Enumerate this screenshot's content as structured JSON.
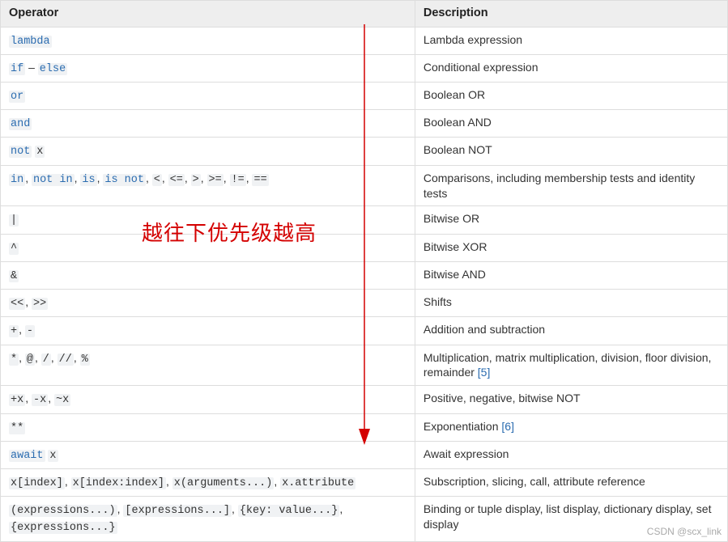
{
  "headers": {
    "operator": "Operator",
    "description": "Description"
  },
  "rows": [
    {
      "op_parts": [
        {
          "t": "link",
          "v": "lambda"
        }
      ],
      "desc_parts": [
        {
          "t": "text",
          "v": "Lambda expression"
        }
      ]
    },
    {
      "op_parts": [
        {
          "t": "link",
          "v": "if"
        },
        {
          "t": "text",
          "v": " – "
        },
        {
          "t": "link",
          "v": "else"
        }
      ],
      "desc_parts": [
        {
          "t": "text",
          "v": "Conditional expression"
        }
      ]
    },
    {
      "op_parts": [
        {
          "t": "link",
          "v": "or"
        }
      ],
      "desc_parts": [
        {
          "t": "text",
          "v": "Boolean OR"
        }
      ]
    },
    {
      "op_parts": [
        {
          "t": "link",
          "v": "and"
        }
      ],
      "desc_parts": [
        {
          "t": "text",
          "v": "Boolean AND"
        }
      ]
    },
    {
      "op_parts": [
        {
          "t": "link",
          "v": "not"
        },
        {
          "t": "text",
          "v": " "
        },
        {
          "t": "code",
          "v": "x"
        }
      ],
      "desc_parts": [
        {
          "t": "text",
          "v": "Boolean NOT"
        }
      ]
    },
    {
      "op_parts": [
        {
          "t": "link",
          "v": "in"
        },
        {
          "t": "text",
          "v": ", "
        },
        {
          "t": "link",
          "v": "not in"
        },
        {
          "t": "text",
          "v": ", "
        },
        {
          "t": "link",
          "v": "is"
        },
        {
          "t": "text",
          "v": ", "
        },
        {
          "t": "link",
          "v": "is not"
        },
        {
          "t": "text",
          "v": ", "
        },
        {
          "t": "code",
          "v": "<"
        },
        {
          "t": "text",
          "v": ", "
        },
        {
          "t": "code",
          "v": "<="
        },
        {
          "t": "text",
          "v": ", "
        },
        {
          "t": "code",
          "v": ">"
        },
        {
          "t": "text",
          "v": ", "
        },
        {
          "t": "code",
          "v": ">="
        },
        {
          "t": "text",
          "v": ", "
        },
        {
          "t": "code",
          "v": "!="
        },
        {
          "t": "text",
          "v": ", "
        },
        {
          "t": "code",
          "v": "=="
        }
      ],
      "desc_parts": [
        {
          "t": "text",
          "v": "Comparisons, including membership tests and identity tests"
        }
      ]
    },
    {
      "op_parts": [
        {
          "t": "code",
          "v": "|"
        }
      ],
      "desc_parts": [
        {
          "t": "text",
          "v": "Bitwise OR"
        }
      ]
    },
    {
      "op_parts": [
        {
          "t": "code",
          "v": "^"
        }
      ],
      "desc_parts": [
        {
          "t": "text",
          "v": "Bitwise XOR"
        }
      ]
    },
    {
      "op_parts": [
        {
          "t": "code",
          "v": "&"
        }
      ],
      "desc_parts": [
        {
          "t": "text",
          "v": "Bitwise AND"
        }
      ]
    },
    {
      "op_parts": [
        {
          "t": "code",
          "v": "<<"
        },
        {
          "t": "text",
          "v": ", "
        },
        {
          "t": "code",
          "v": ">>"
        }
      ],
      "desc_parts": [
        {
          "t": "text",
          "v": "Shifts"
        }
      ]
    },
    {
      "op_parts": [
        {
          "t": "code",
          "v": "+"
        },
        {
          "t": "text",
          "v": ", "
        },
        {
          "t": "code",
          "v": "-"
        }
      ],
      "desc_parts": [
        {
          "t": "text",
          "v": "Addition and subtraction"
        }
      ]
    },
    {
      "op_parts": [
        {
          "t": "code",
          "v": "*"
        },
        {
          "t": "text",
          "v": ", "
        },
        {
          "t": "code",
          "v": "@"
        },
        {
          "t": "text",
          "v": ", "
        },
        {
          "t": "code",
          "v": "/"
        },
        {
          "t": "text",
          "v": ", "
        },
        {
          "t": "code",
          "v": "//"
        },
        {
          "t": "text",
          "v": ", "
        },
        {
          "t": "code",
          "v": "%"
        }
      ],
      "desc_parts": [
        {
          "t": "text",
          "v": "Multiplication, matrix multiplication, division, floor division, remainder "
        },
        {
          "t": "ref",
          "v": "[5]"
        }
      ]
    },
    {
      "op_parts": [
        {
          "t": "code",
          "v": "+x"
        },
        {
          "t": "text",
          "v": ", "
        },
        {
          "t": "code",
          "v": "-x"
        },
        {
          "t": "text",
          "v": ", "
        },
        {
          "t": "code",
          "v": "~x"
        }
      ],
      "desc_parts": [
        {
          "t": "text",
          "v": "Positive, negative, bitwise NOT"
        }
      ]
    },
    {
      "op_parts": [
        {
          "t": "code",
          "v": "**"
        }
      ],
      "desc_parts": [
        {
          "t": "text",
          "v": "Exponentiation "
        },
        {
          "t": "ref",
          "v": "[6]"
        }
      ]
    },
    {
      "op_parts": [
        {
          "t": "link",
          "v": "await"
        },
        {
          "t": "text",
          "v": " "
        },
        {
          "t": "code",
          "v": "x"
        }
      ],
      "desc_parts": [
        {
          "t": "text",
          "v": "Await expression"
        }
      ]
    },
    {
      "op_parts": [
        {
          "t": "code",
          "v": "x[index]"
        },
        {
          "t": "text",
          "v": ", "
        },
        {
          "t": "code",
          "v": "x[index:index]"
        },
        {
          "t": "text",
          "v": ", "
        },
        {
          "t": "code",
          "v": "x(arguments...)"
        },
        {
          "t": "text",
          "v": ", "
        },
        {
          "t": "code",
          "v": "x.attribute"
        }
      ],
      "desc_parts": [
        {
          "t": "text",
          "v": "Subscription, slicing, call, attribute reference"
        }
      ]
    },
    {
      "op_parts": [
        {
          "t": "code",
          "v": "(expressions...)"
        },
        {
          "t": "text",
          "v": ", "
        },
        {
          "t": "code",
          "v": "[expressions...]"
        },
        {
          "t": "text",
          "v": ", "
        },
        {
          "t": "code",
          "v": "{key: value...}"
        },
        {
          "t": "text",
          "v": ", "
        },
        {
          "t": "code",
          "v": "{expressions...}"
        }
      ],
      "desc_parts": [
        {
          "t": "text",
          "v": "Binding or tuple display, list display, dictionary display, set display"
        }
      ]
    }
  ],
  "annotation": "越往下优先级越高",
  "watermark": "CSDN @scx_link",
  "arrow_color": "#d40000"
}
